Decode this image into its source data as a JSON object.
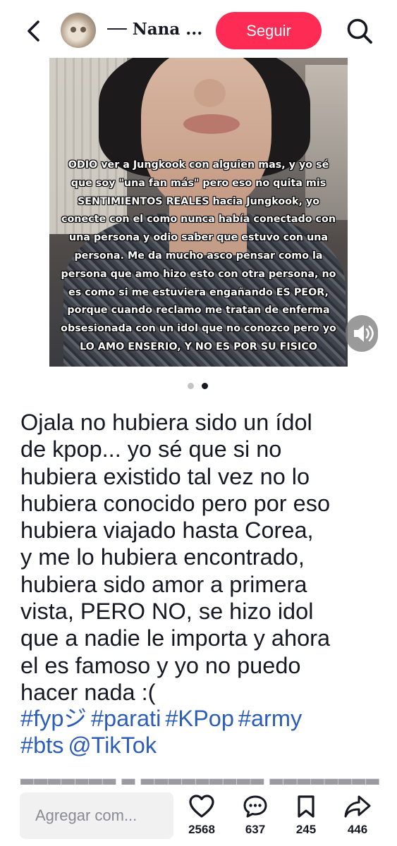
{
  "header": {
    "username": "── Nana ...",
    "follow_label": "Seguir"
  },
  "media": {
    "caption_lines": [
      "ODIO ver a Jungkook con alguien mas, y yo sé",
      "que soy \"una fan más\" pero eso no quita mis",
      "SENTIMIENTOS REALES hacia Jungkook, yo",
      "conecte con el como nunca había conectado con",
      "una persona y odio saber que estuvo con una",
      "persona. Me da mucho asco pensar como la",
      "persona que amo hizo esto con otra persona, no",
      "es como si me estuviera engañando ES PEOR,",
      "porque cuando reclamo me tratan de enferma",
      "obsesionada con un idol que no conozco pero yo",
      "LO AMO ENSERIO, Y NO ES POR SU FISICO"
    ],
    "carousel": {
      "total": 2,
      "active": 2
    }
  },
  "description": {
    "lines": [
      "Ojala no hubiera sido un ídol",
      "de kpop... yo sé que si no",
      "hubiera existido tal vez no lo",
      "hubiera conocido pero por eso",
      "hubiera viajado hasta Corea,",
      "y me lo hubiera encontrado,",
      "hubiera sido amor a primera",
      "vista, PERO NO, se hizo idol",
      "que a nadie le importa y ahora",
      "el es famoso y yo no puedo",
      "hacer nada :("
    ],
    "tags_line1": [
      "#fypジ",
      "#parati",
      "#KPop",
      "#army"
    ],
    "tags_line2": [
      "#bts",
      "@TikTok"
    ]
  },
  "bottom_bar": {
    "comment_placeholder": "Agregar com...",
    "likes": "2568",
    "comments": "637",
    "saves": "245",
    "shares": "446"
  },
  "colors": {
    "accent": "#fe2c55",
    "hashtag": "#2b5db9",
    "text": "#161823"
  },
  "icons": [
    "back-arrow-icon",
    "search-icon",
    "sound-icon",
    "heart-icon",
    "comment-icon",
    "bookmark-icon",
    "share-icon"
  ]
}
